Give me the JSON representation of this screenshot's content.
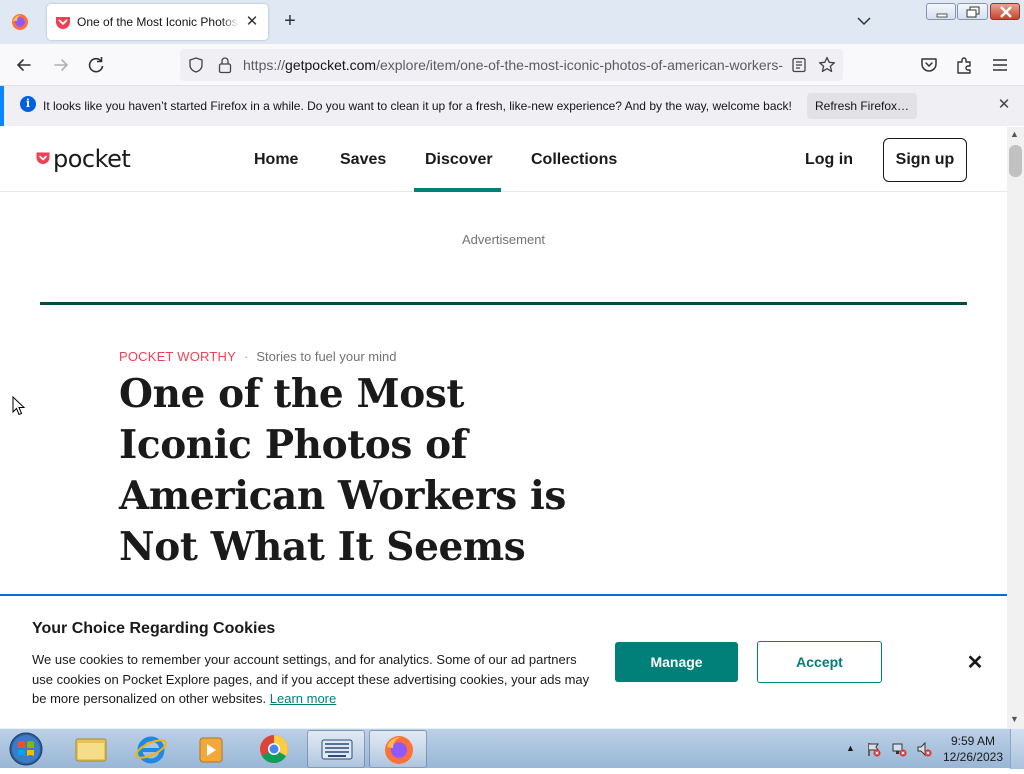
{
  "browser": {
    "tab_title": "One of the Most Iconic Photos of American Workers is Not What It Seems",
    "url_prefix": "https://",
    "url_host": "getpocket.com",
    "url_path": "/explore/item/one-of-the-most-iconic-photos-of-american-workers-is-not-what-it-seems",
    "notification_text": "It looks like you haven’t started Firefox in a while. Do you want to clean it up for a fresh, like-new experience? And by the way, welcome back!",
    "refresh_label": "Refresh Firefox…"
  },
  "site": {
    "logo_text": "pocket",
    "nav": {
      "home": "Home",
      "saves": "Saves",
      "discover": "Discover",
      "collections": "Collections"
    },
    "login_label": "Log in",
    "signup_label": "Sign up",
    "brand_color": "#008078",
    "accent_red": "#ef4056"
  },
  "article": {
    "advertisement_label": "Advertisement",
    "eyebrow_tag": "POCKET WORTHY",
    "eyebrow_separator": "·",
    "eyebrow_sub": "Stories to fuel your mind",
    "headline": "One of the Most Iconic Photos of American Workers is Not What It Seems"
  },
  "cookies": {
    "title": "Your Choice Regarding Cookies",
    "body": "We use cookies to remember your account settings, and for analytics. Some of our ad partners use cookies on Pocket Explore pages, and if you accept these advertising cookies, your ads may be more personalized on other websites.",
    "learn_more": "Learn more",
    "manage_label": "Manage",
    "accept_label": "Accept"
  },
  "taskbar": {
    "time": "9:59 AM",
    "date": "12/26/2023",
    "apps": [
      "windows-explorer-icon",
      "internet-explorer-icon",
      "media-player-icon",
      "chrome-icon",
      "keyboard-app-icon",
      "firefox-icon"
    ]
  }
}
